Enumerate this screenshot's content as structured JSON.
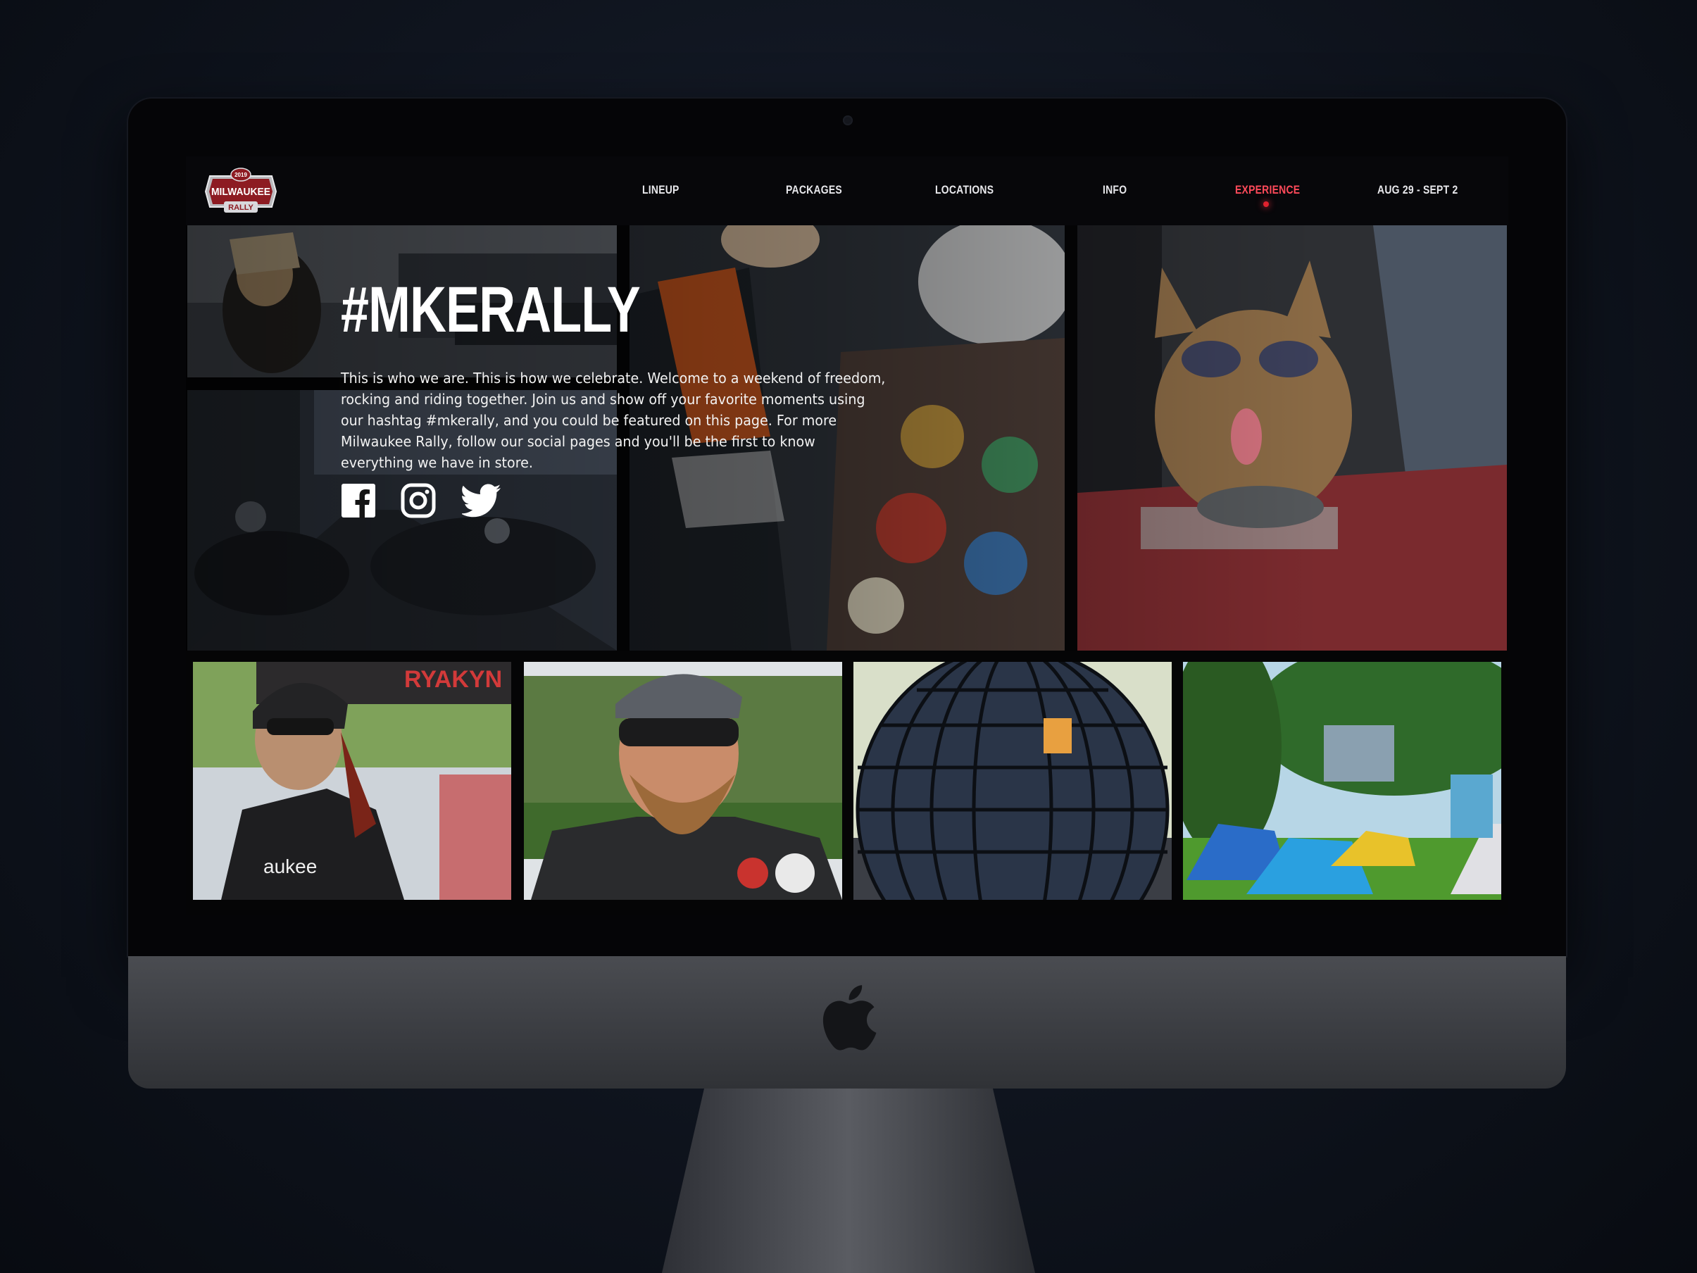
{
  "site": {
    "logo_year": "2019",
    "logo_top": "MILWAUKEE",
    "logo_bottom": "RALLY"
  },
  "nav": {
    "items": [
      {
        "label": "LINEUP"
      },
      {
        "label": "PACKAGES"
      },
      {
        "label": "LOCATIONS"
      },
      {
        "label": "INFO"
      },
      {
        "label": "EXPERIENCE",
        "active": true
      },
      {
        "label": "AUG 29 - SEPT 2"
      }
    ]
  },
  "hero": {
    "headline": "#MKERALLY",
    "intro": "This is who we are. This is how we celebrate. Welcome to a weekend of freedom, rocking and riding together. Join us and show off your favorite moments using our hashtag #mkerally, and you could be featured on this page. For more Milwaukee Rally, follow our social pages and you'll be the first to know everything we have in store."
  },
  "social": [
    {
      "icon": "facebook-icon"
    },
    {
      "icon": "instagram-icon"
    },
    {
      "icon": "twitter-icon"
    }
  ],
  "gallery": {
    "tent_banner_text": "RYAKYN",
    "vest_text": "aukee"
  },
  "colors": {
    "accent": "#e0222e",
    "active_nav": "#ff4a5a",
    "background": "#050506"
  }
}
